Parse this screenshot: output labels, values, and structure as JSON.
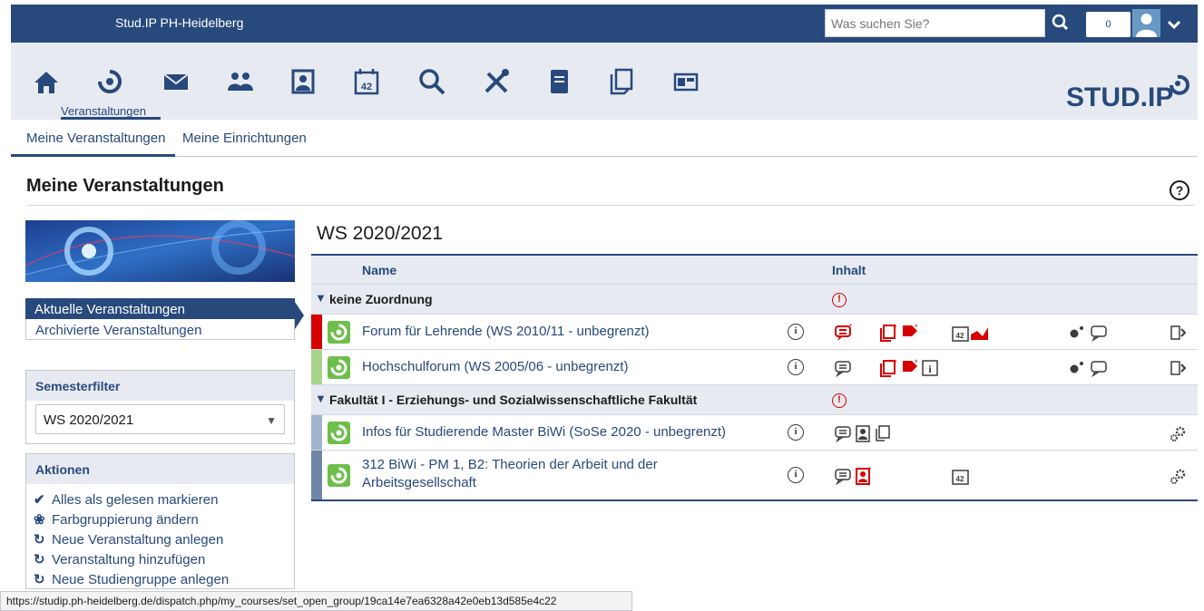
{
  "header": {
    "site_name": "Stud.IP PH-Heidelberg",
    "search_placeholder": "Was suchen Sie?",
    "notification_count": "0"
  },
  "iconbar": {
    "items": [
      "home-icon",
      "courses-icon",
      "messages-icon",
      "community-icon",
      "profile-icon",
      "schedule-icon",
      "search-icon",
      "tools-icon",
      "document-icon",
      "files-icon",
      "workplace-icon"
    ],
    "active_label": "Veranstaltungen",
    "logo_text": "STUD.IP"
  },
  "tabs": {
    "items": [
      "Meine Veranstaltungen",
      "Meine Einrichtungen"
    ],
    "active": "Meine Veranstaltungen"
  },
  "page": {
    "title": "Meine Veranstaltungen"
  },
  "sidebar": {
    "views": [
      "Aktuelle Veranstaltungen",
      "Archivierte Veranstaltungen"
    ],
    "semester_filter": {
      "title": "Semesterfilter",
      "selected": "WS 2020/2021"
    },
    "actions": {
      "title": "Aktionen",
      "items": [
        {
          "label": "Alles als gelesen markieren",
          "icon": "check-icon"
        },
        {
          "label": "Farbgruppierung ändern",
          "icon": "palette-icon"
        },
        {
          "label": "Neue Veranstaltung anlegen",
          "icon": "course-add-icon"
        },
        {
          "label": "Veranstaltung hinzufügen",
          "icon": "course-icon"
        },
        {
          "label": "Neue Studiengruppe anlegen",
          "icon": "studygroup-add-icon"
        }
      ]
    }
  },
  "main": {
    "semester": "WS 2020/2021",
    "columns": [
      "Name",
      "Inhalt"
    ],
    "groups": [
      {
        "name": "keine Zuordnung",
        "courses": [
          {
            "name": "Forum für Lehrende (WS 2010/11 - unbegrenzt)",
            "color": "#d60000"
          },
          {
            "name": "Hochschulforum (WS 2005/06 - unbegrenzt)",
            "color": "#a9d38d"
          }
        ]
      },
      {
        "name": "Fakultät I - Erziehungs- und Sozialwissenschaftliche Fakultät",
        "courses": [
          {
            "name": "Infos für Studierende Master BiWi (SoSe 2020 - unbegrenzt)",
            "color": "#a2b4cd"
          },
          {
            "name": "312 BiWi - PM 1, B2: Theorien der Arbeit und der Arbeitsgesellschaft",
            "color": "#6f86a6"
          }
        ]
      }
    ]
  },
  "status_url": "https://studip.ph-heidelberg.de/dispatch.php/my_courses/set_open_group/19ca14e7ea6328a42e0eb13d585e4c22",
  "colors": {
    "primary": "#28497c",
    "accent_red": "#d60000",
    "course_green": "#6ebe4b"
  }
}
